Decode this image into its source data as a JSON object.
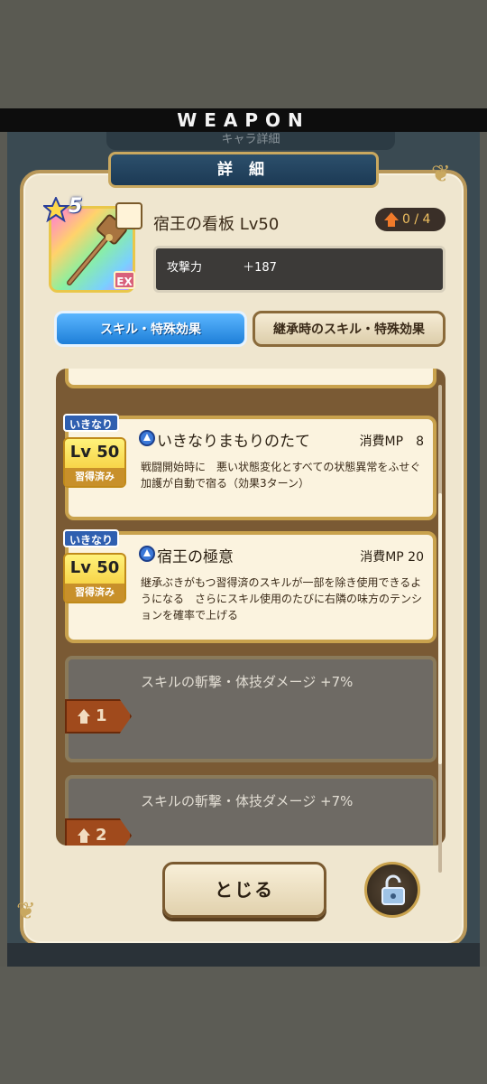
{
  "banner": {
    "title": "WEAPON"
  },
  "behind": {
    "title": "キャラ詳細"
  },
  "header": {
    "title": "詳 細"
  },
  "item": {
    "stars": "5",
    "rarity_badge": "EX",
    "name": "宿王の看板 Lv50",
    "upgrade": "0 / 4",
    "stat_label": "攻撃力",
    "stat_value": "＋187"
  },
  "tabs": [
    {
      "label": "スキル・特殊効果",
      "active": true
    },
    {
      "label": "継承時のスキル・特殊効果",
      "active": false
    }
  ],
  "skills": [
    {
      "tag": "いきなり",
      "level": "Lv 50",
      "learned": "習得済み",
      "name": "いきなりまもりのたて",
      "mp": "消費MP　8",
      "desc": "戦闘開始時に　悪い状態変化とすべての状態異常をふせぐ加護が自動で宿る（効果3ターン）"
    },
    {
      "tag": "いきなり",
      "level": "Lv 50",
      "learned": "習得済み",
      "name": "宿王の極意",
      "mp": "消費MP 20",
      "desc": "継承ぶきがもつ習得済のスキルが一部を除き使用できるようになる　さらにスキル使用のたびに右隣の味方のテンションを確率で上げる"
    }
  ],
  "bonuses": [
    {
      "text": "スキルの斬撃・体技ダメージ +7%",
      "rank": "1"
    },
    {
      "text": "スキルの斬撃・体技ダメージ +7%",
      "rank": "2"
    }
  ],
  "buttons": {
    "close": "とじる"
  },
  "icons": {
    "item": "staff-icon",
    "lock": "unlock-icon",
    "skill": "skill-type-icon"
  },
  "colors": {
    "accent_blue": "#1e7fd8",
    "gold": "#c9a24d",
    "upgrade_orange": "#f07a2a"
  }
}
